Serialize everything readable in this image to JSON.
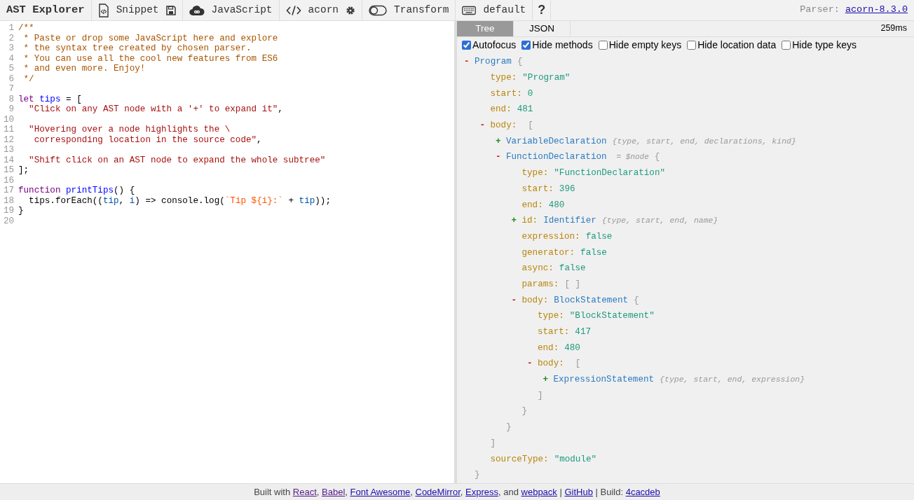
{
  "toolbar": {
    "title": "AST Explorer",
    "items": [
      {
        "kind": "snippet",
        "label": "Snippet"
      },
      {
        "kind": "language",
        "label": "JavaScript"
      },
      {
        "kind": "parser",
        "label": "acorn"
      },
      {
        "kind": "transform",
        "label": "Transform",
        "on": false
      },
      {
        "kind": "keymap",
        "label": "default"
      },
      {
        "kind": "help",
        "label": "?"
      }
    ],
    "parser_label": "Parser:",
    "parser_link": "acorn-8.3.0"
  },
  "editor": {
    "lines": [
      {
        "number": "1",
        "tokens": [
          {
            "kind": "comment",
            "text": "/**"
          }
        ]
      },
      {
        "number": "2",
        "tokens": [
          {
            "kind": "comment",
            "text": " * Paste or drop some JavaScript here and explore"
          }
        ]
      },
      {
        "number": "3",
        "tokens": [
          {
            "kind": "comment",
            "text": " * the syntax tree created by chosen parser."
          }
        ]
      },
      {
        "number": "4",
        "tokens": [
          {
            "kind": "comment",
            "text": " * You can use all the cool new features from ES6"
          }
        ]
      },
      {
        "number": "5",
        "tokens": [
          {
            "kind": "comment",
            "text": " * and even more. Enjoy!"
          }
        ]
      },
      {
        "number": "6",
        "tokens": [
          {
            "kind": "comment",
            "text": " */"
          }
        ]
      },
      {
        "number": "7"
      },
      {
        "number": "8",
        "tokens": [
          {
            "kind": "keyword",
            "text": "let"
          },
          {
            "kind": "def",
            "text": " tips"
          },
          {
            "kind": "plain",
            "text": " = ["
          }
        ]
      },
      {
        "number": "9",
        "tokens": [
          {
            "kind": "string",
            "text": "  \"Click on any AST node with a '+' to expand it\""
          },
          {
            "kind": "plain",
            "text": ","
          }
        ]
      },
      {
        "number": "10"
      },
      {
        "number": "11",
        "tokens": [
          {
            "kind": "string",
            "text": "  \"Hovering over a node highlights the \\"
          }
        ]
      },
      {
        "number": "12",
        "tokens": [
          {
            "kind": "string",
            "text": "   corresponding location in the source code\""
          },
          {
            "kind": "plain",
            "text": ","
          }
        ]
      },
      {
        "number": "13"
      },
      {
        "number": "14",
        "tokens": [
          {
            "kind": "string",
            "text": "  \"Shift click on an AST node to expand the whole subtree\""
          }
        ]
      },
      {
        "number": "15",
        "tokens": [
          {
            "kind": "plain",
            "text": "];"
          }
        ]
      },
      {
        "number": "16"
      },
      {
        "number": "17",
        "tokens": [
          {
            "kind": "keyword",
            "text": "function"
          },
          {
            "kind": "def",
            "text": " printTips"
          },
          {
            "kind": "plain",
            "text": "() {"
          }
        ]
      },
      {
        "number": "18",
        "tokens": [
          {
            "kind": "plain",
            "text": "  tips.forEach(("
          },
          {
            "kind": "variable",
            "text": "tip"
          },
          {
            "kind": "plain",
            "text": ", "
          },
          {
            "kind": "variable",
            "text": "i"
          },
          {
            "kind": "plain",
            "text": ") => console.log("
          },
          {
            "kind": "template",
            "text": "`Tip ${i}:`"
          },
          {
            "kind": "plain",
            "text": " + "
          },
          {
            "kind": "variable",
            "text": "tip"
          },
          {
            "kind": "plain",
            "text": "));"
          }
        ]
      },
      {
        "number": "19",
        "tokens": [
          {
            "kind": "plain",
            "text": "}"
          }
        ]
      },
      {
        "number": "20"
      }
    ]
  },
  "output": {
    "tabs": [
      {
        "label": "Tree",
        "selected": true
      },
      {
        "label": "JSON",
        "selected": false
      }
    ],
    "time": "259ms",
    "options": [
      {
        "label": "Autofocus",
        "checked": true
      },
      {
        "label": "Hide methods",
        "checked": true
      },
      {
        "label": "Hide empty keys",
        "checked": false
      },
      {
        "label": "Hide location data",
        "checked": false
      },
      {
        "label": "Hide type keys",
        "checked": false
      }
    ],
    "tree": {
      "kind": "object",
      "toggle": "-",
      "expanded": true,
      "type": "Program",
      "open": "{",
      "close": "}",
      "children": [
        {
          "kind": "prop",
          "key": "type:",
          "value": "\"Program\""
        },
        {
          "kind": "prop",
          "key": "start:",
          "value": "0"
        },
        {
          "kind": "prop",
          "key": "end:",
          "value": "481"
        },
        {
          "kind": "array",
          "toggle": "-",
          "expanded": true,
          "key": "body:",
          "open": "[",
          "close": "]",
          "children": [
            {
              "kind": "object",
              "toggle": "+",
              "expanded": false,
              "type": "VariableDeclaration",
              "summary": "{type, start, end, declarations, kind}"
            },
            {
              "kind": "object",
              "toggle": "-",
              "expanded": true,
              "type": "FunctionDeclaration",
              "note": "= $node",
              "open": "{",
              "close": "}",
              "children": [
                {
                  "kind": "prop",
                  "key": "type:",
                  "value": "\"FunctionDeclaration\""
                },
                {
                  "kind": "prop",
                  "key": "start:",
                  "value": "396"
                },
                {
                  "kind": "prop",
                  "key": "end:",
                  "value": "480"
                },
                {
                  "kind": "object",
                  "toggle": "+",
                  "expanded": false,
                  "key": "id:",
                  "type": "Identifier",
                  "summary": "{type, start, end, name}"
                },
                {
                  "kind": "prop",
                  "key": "expression:",
                  "value": "false"
                },
                {
                  "kind": "prop",
                  "key": "generator:",
                  "value": "false"
                },
                {
                  "kind": "prop",
                  "key": "async:",
                  "value": "false"
                },
                {
                  "kind": "empty",
                  "key": "params:",
                  "value": "[ ]"
                },
                {
                  "kind": "object",
                  "toggle": "-",
                  "expanded": true,
                  "key": "body:",
                  "type": "BlockStatement",
                  "open": "{",
                  "close": "}",
                  "children": [
                    {
                      "kind": "prop",
                      "key": "type:",
                      "value": "\"BlockStatement\""
                    },
                    {
                      "kind": "prop",
                      "key": "start:",
                      "value": "417"
                    },
                    {
                      "kind": "prop",
                      "key": "end:",
                      "value": "480"
                    },
                    {
                      "kind": "array",
                      "toggle": "-",
                      "expanded": true,
                      "key": "body:",
                      "open": "[",
                      "close": "]",
                      "children": [
                        {
                          "kind": "object",
                          "toggle": "+",
                          "expanded": false,
                          "type": "ExpressionStatement",
                          "summary": "{type, start, end, expression}"
                        }
                      ]
                    }
                  ]
                }
              ]
            }
          ]
        },
        {
          "kind": "prop",
          "key": "sourceType:",
          "value": "\"module\""
        }
      ]
    }
  },
  "footer": [
    {
      "kind": "text",
      "text": "Built with "
    },
    {
      "kind": "link",
      "text": "React",
      "visited": true
    },
    {
      "kind": "text",
      "text": ", "
    },
    {
      "kind": "link",
      "text": "Babel",
      "visited": true
    },
    {
      "kind": "text",
      "text": ", "
    },
    {
      "kind": "link",
      "text": "Font Awesome",
      "visited": false
    },
    {
      "kind": "text",
      "text": ", "
    },
    {
      "kind": "link",
      "text": "CodeMirror",
      "visited": false
    },
    {
      "kind": "text",
      "text": ", "
    },
    {
      "kind": "link",
      "text": "Express",
      "visited": false
    },
    {
      "kind": "text",
      "text": ", and "
    },
    {
      "kind": "link",
      "text": "webpack",
      "visited": false
    },
    {
      "kind": "text",
      "text": " | "
    },
    {
      "kind": "link",
      "text": "GitHub",
      "visited": false
    },
    {
      "kind": "text",
      "text": " | Build: "
    },
    {
      "kind": "link",
      "text": "4cacdeb",
      "visited": false
    }
  ]
}
